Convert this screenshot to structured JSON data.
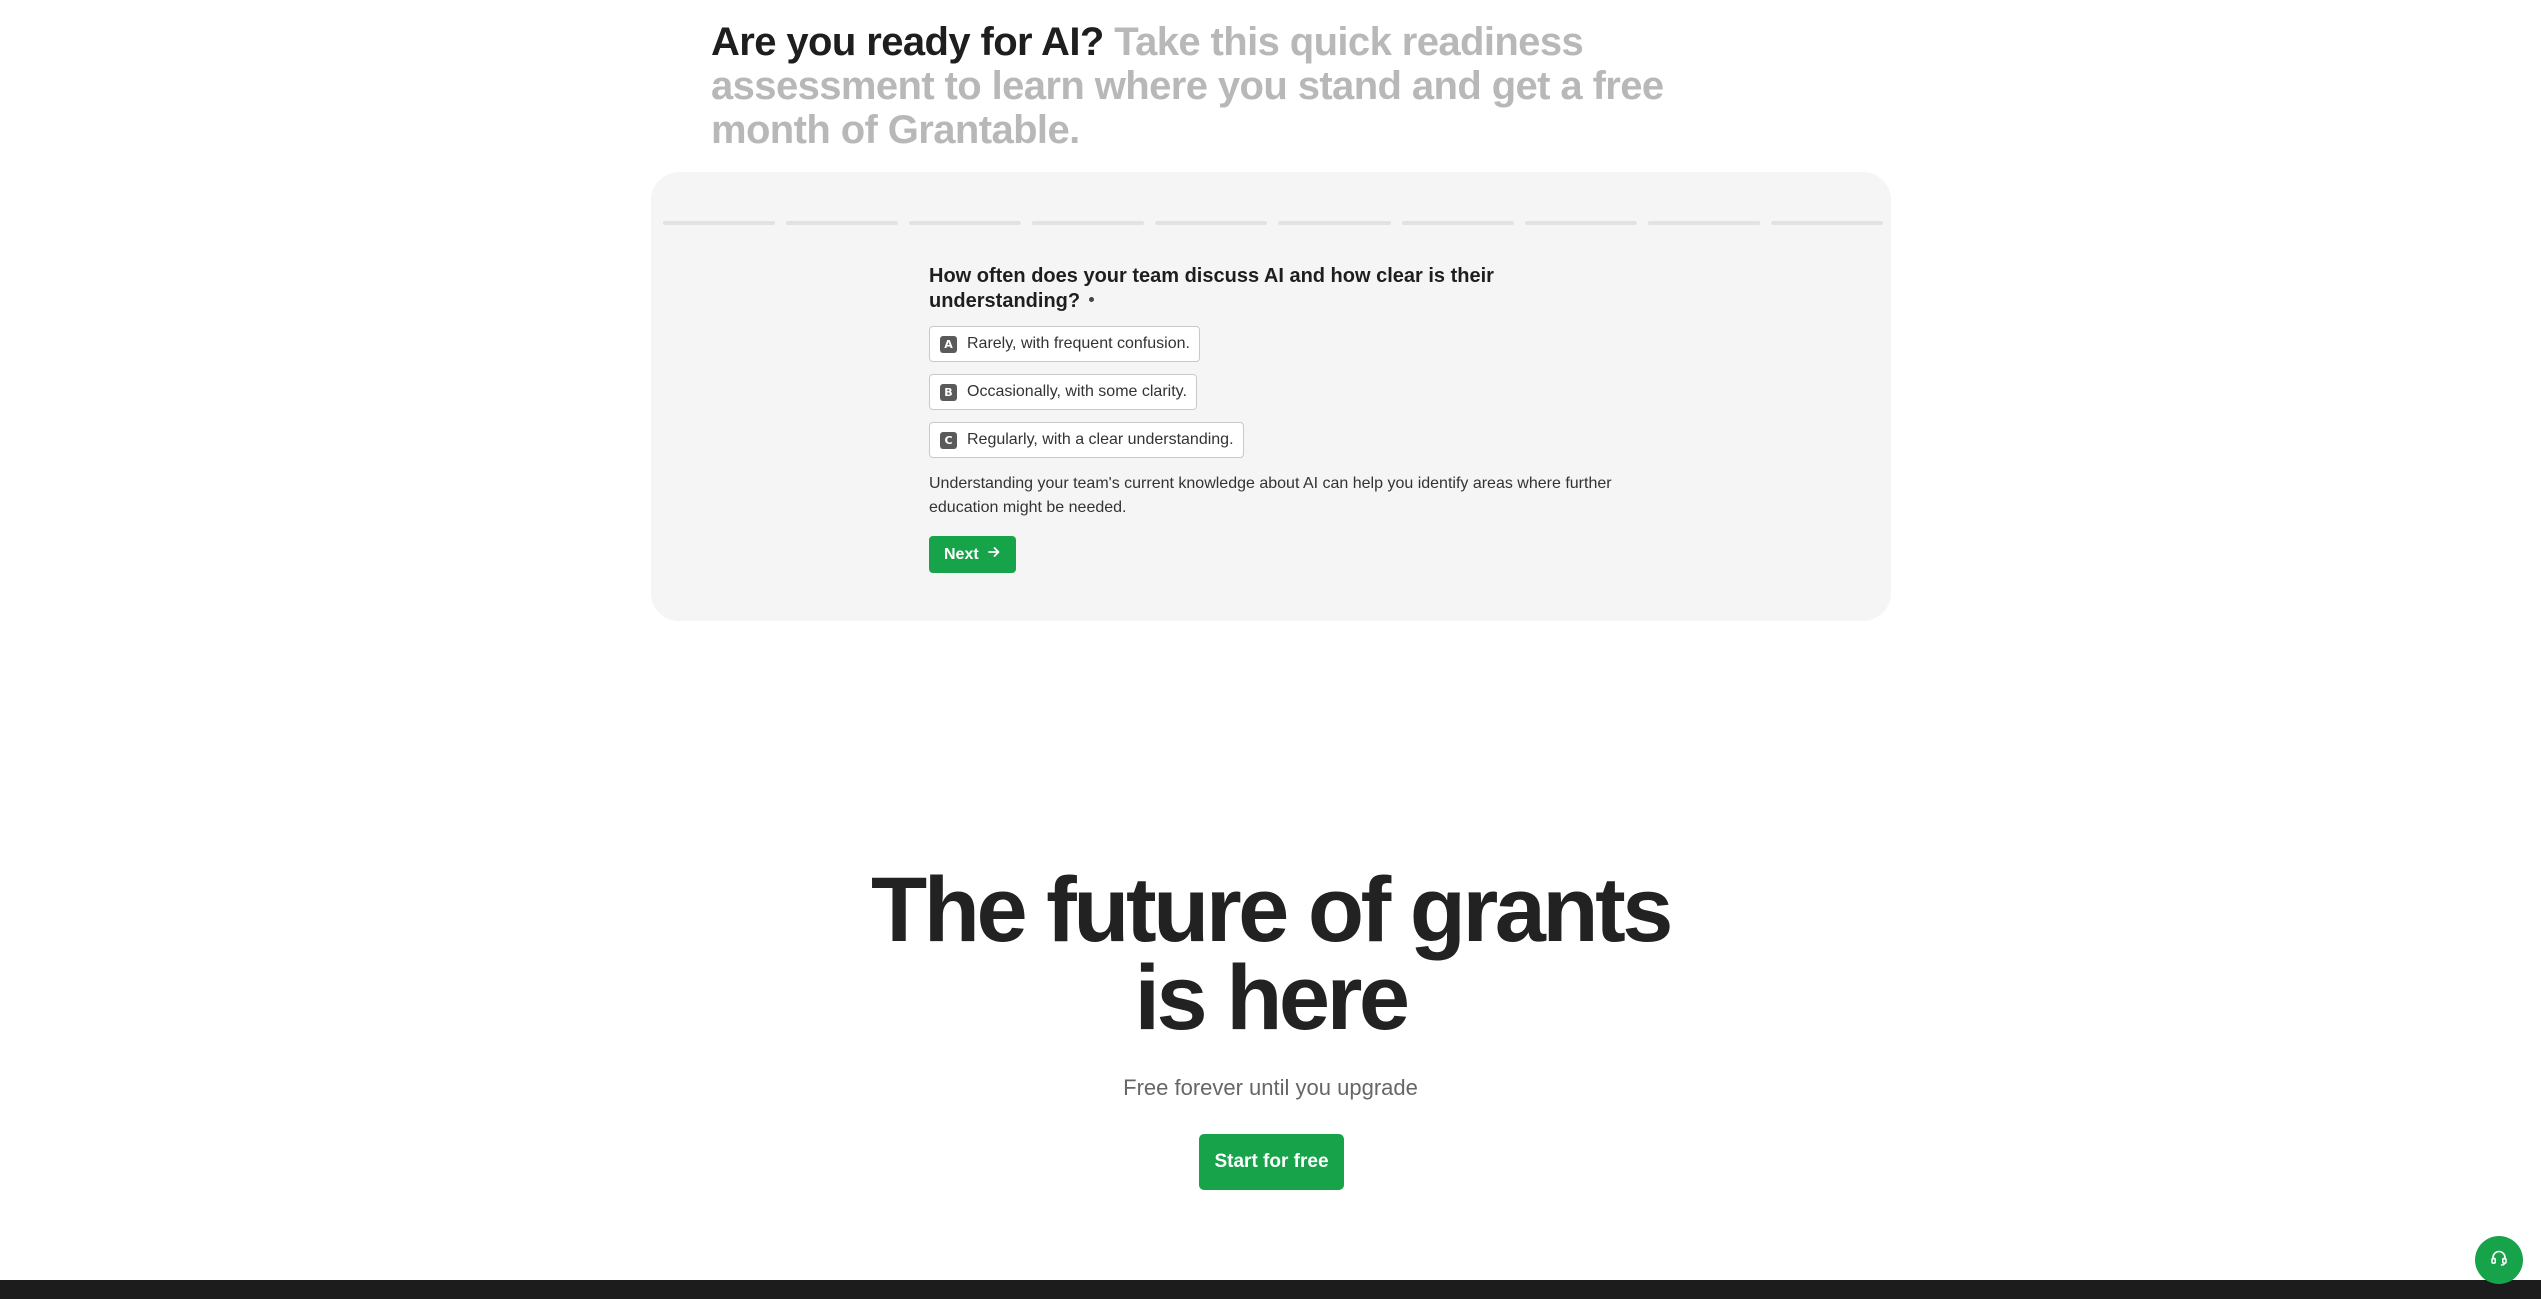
{
  "hero": {
    "title": "Are you ready for AI?",
    "subtitle": "Take this quick readiness assessment to learn where you stand and get a free month of Grantable."
  },
  "assessment": {
    "progress": {
      "total_steps": 10,
      "completed_steps": 0
    },
    "question": "How often does your team discuss AI and how clear is their understanding?",
    "options": [
      {
        "key": "A",
        "label": "Rarely, with frequent confusion."
      },
      {
        "key": "B",
        "label": "Occasionally, with some clarity."
      },
      {
        "key": "C",
        "label": "Regularly, with a clear understanding."
      }
    ],
    "hint": "Understanding your team's current knowledge about AI can help you identify areas where further education might be needed.",
    "next_label": "Next"
  },
  "cta": {
    "title_line1": "The future of grants",
    "title_line2": "is here",
    "subtitle": "Free forever until you upgrade",
    "button_label": "Start for free"
  },
  "support": {
    "icon": "headset-icon"
  },
  "colors": {
    "accent": "#16a34a",
    "card_bg": "#f5f5f5",
    "muted_text": "#b8b8b8"
  }
}
